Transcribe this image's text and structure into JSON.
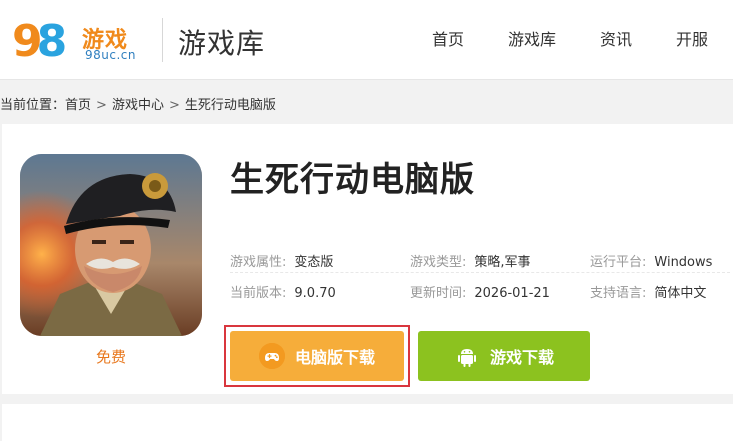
{
  "header": {
    "logo": {
      "digits_a": "9",
      "digits_b": "8",
      "brand_cn": "游戏",
      "domain": "98uc.cn"
    },
    "section_title": "游戏库",
    "nav": [
      "首页",
      "游戏库",
      "资讯",
      "开服"
    ]
  },
  "breadcrumb": {
    "prefix": "当前位置：",
    "items": [
      "首页",
      "游戏中心",
      "生死行动电脑版"
    ],
    "separator": ">"
  },
  "game": {
    "title": "生死行动电脑版",
    "price_label": "免费",
    "info": [
      [
        {
          "key": "游戏属性:",
          "value": "变态版"
        },
        {
          "key": "游戏类型:",
          "value": "策略,军事"
        },
        {
          "key": "运行平台:",
          "value": "Windows"
        }
      ],
      [
        {
          "key": "当前版本:",
          "value": "9.0.70"
        },
        {
          "key": "更新时间:",
          "value": "2026-01-21"
        },
        {
          "key": "支持语言:",
          "value": "简体中文"
        }
      ]
    ],
    "buttons": {
      "pc_download": "电脑版下载",
      "game_download": "游戏下载"
    }
  },
  "colors": {
    "accent_orange": "#f6ad3a",
    "accent_green": "#8cc21f",
    "highlight_red": "#d9363e",
    "free_orange": "#e8781e"
  },
  "icons": {
    "pc_button_icon": "gamepad-icon",
    "game_button_icon": "android-icon"
  }
}
